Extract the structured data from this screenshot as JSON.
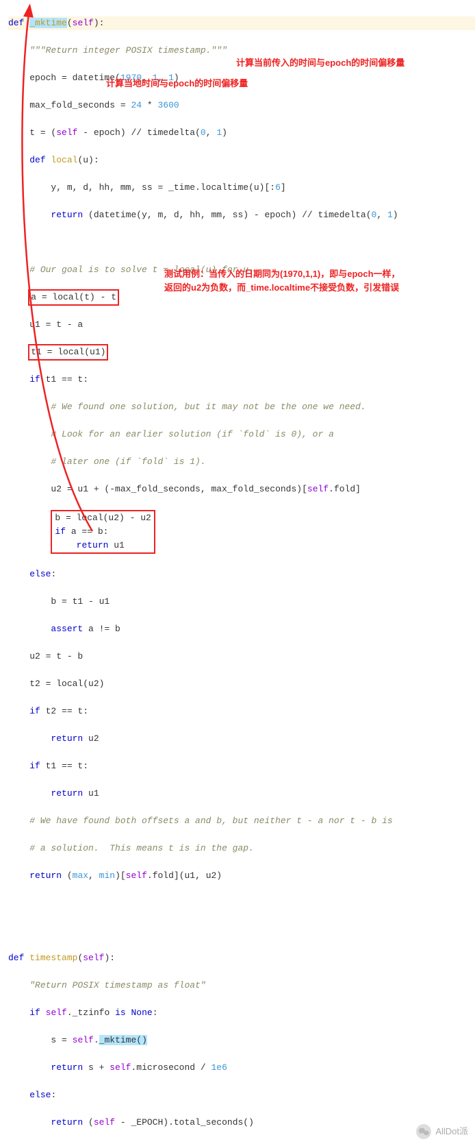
{
  "code": {
    "def_mktime": "def ",
    "mktime_name": "_mktime",
    "mktime_args": "(self):",
    "docstring": "\"\"\"Return integer POSIX timestamp.\"\"\"",
    "l_epoch_a": "epoch = datetime(",
    "l_epoch_nums": "1970, 1, 1",
    "l_epoch_b": ")",
    "l_maxfold_a": "max_fold_seconds = ",
    "l_maxfold_b": "24",
    "l_maxfold_c": " * ",
    "l_maxfold_d": "3600",
    "l_t_a": "t = (",
    "l_t_self": "self",
    "l_t_b": " - epoch) // timedelta(",
    "l_t_c": "0, 1",
    "l_t_d": ")",
    "l_deflocal": "def ",
    "l_deflocal_name": "local",
    "l_deflocal_args": "(u):",
    "l_loc1_a": "y, m, d, hh, mm, ss = _time.localtime(u)[:",
    "l_loc1_b": "6",
    "l_loc1_c": "]",
    "l_loc2_a": "return",
    "l_loc2_b": " (datetime(y, m, d, hh, mm, ss) - epoch) // timedelta(",
    "l_loc2_c": "0, 1",
    "l_loc2_d": ")",
    "cmt_goal": "# Our goal is to solve t = local(u) for u.",
    "l_a": "a = local(t) - t",
    "l_u1": "u1 = t - a",
    "l_t1": "t1 = local(u1)",
    "l_if_t1": "if",
    "l_if_t1_b": " t1 == t:",
    "cmt_found1": "# We found one solution, but it may not be the one we need.",
    "cmt_found2": "# Look for an earlier solution (if `fold` is 0), or a",
    "cmt_found3": "# later one (if `fold` is 1).",
    "l_u2_a": "u2 = u1 + (-max_fold_seconds, max_fold_seconds)[",
    "l_u2_self": "self",
    "l_u2_b": ".fold]",
    "l_b": "b = local(u2) - u2",
    "l_ifab_a": "if",
    "l_ifab_b": " a == b:",
    "l_retu1_a": "return",
    "l_retu1_b": " u1",
    "l_else": "else",
    "l_else_b": ":",
    "l_b2": "b = t1 - u1",
    "l_assert_a": "assert",
    "l_assert_b": " a != b",
    "l_u2b": "u2 = t - b",
    "l_t2": "t2 = local(u2)",
    "l_ift2_a": "if",
    "l_ift2_b": " t2 == t:",
    "l_retu2_a": "return",
    "l_retu2_b": " u2",
    "l_ift1b_a": "if",
    "l_ift1b_b": " t1 == t:",
    "l_retu1b_a": "return",
    "l_retu1b_b": " u1",
    "cmt_both1": "# We have found both offsets a and b, but neither t - a nor t - b is",
    "cmt_both2": "# a solution.  This means t is in the gap.",
    "l_retmax_a": "return",
    "l_retmax_b": " (",
    "l_retmax_max": "max",
    "l_retmax_c": ", ",
    "l_retmax_min": "min",
    "l_retmax_d": ")[",
    "l_retmax_self": "self",
    "l_retmax_e": ".fold](u1, u2)",
    "def_ts": "def ",
    "ts_name": "timestamp",
    "ts_args": "(self):",
    "ts_doc": "\"Return POSIX timestamp as float\"",
    "l_iftz_a": "if",
    "l_iftz_b": " ",
    "l_iftz_self": "self",
    "l_iftz_c": "._tzinfo ",
    "l_iftz_is": "is None",
    "l_iftz_d": ":",
    "l_s_a": "s = ",
    "l_s_self": "self",
    "l_s_b": ".",
    "l_s_call": "_mktime()",
    "l_rets_a": "return",
    "l_rets_b": " s + ",
    "l_rets_self": "self",
    "l_rets_c": ".microsecond / ",
    "l_rets_d": "1e6",
    "l_else2": "else",
    "l_else2_b": ":",
    "l_retep_a": "return",
    "l_retep_b": " (",
    "l_retep_self": "self",
    "l_retep_c": " - _EPOCH).total_seconds()"
  },
  "annotations": {
    "a1": "计算当前传入的时间与epoch的时间偏移量",
    "a2": "计算当地时间与epoch的时间偏移量",
    "a3_l1": "测试用例：当传入的日期同为(1970,1,1)，即与epoch一样，",
    "a3_l2": "返回的u2为负数，而_time.localtime不接受负数，引发错误"
  },
  "watermark": {
    "label": "AllDot派"
  }
}
